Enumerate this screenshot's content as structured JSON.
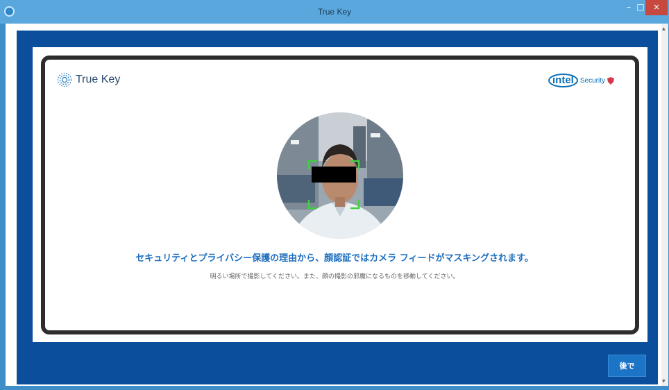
{
  "window": {
    "title": "True Key",
    "minimize_label": "–",
    "maximize_label": "□",
    "close_label": "×"
  },
  "header": {
    "brand_name": "True Key",
    "partner_logo": {
      "intel": "intel",
      "security": "Security"
    }
  },
  "camera": {
    "face_masked": true,
    "face_frame_color": "#3fd13f"
  },
  "messages": {
    "main": "セキュリティとプライバシー保護の理由から、顔認証ではカメラ フィードがマスキングされます。",
    "sub": "明るい場所で撮影してください。また、顔の撮影の邪魔になるものを移動してください。"
  },
  "footer": {
    "later_button": "後で"
  },
  "colors": {
    "window_blue": "#0b4f9c",
    "titlebar": "#5aa7dd",
    "accent_text": "#1e6fbf",
    "button": "#1b74c5",
    "close": "#c7483f"
  }
}
